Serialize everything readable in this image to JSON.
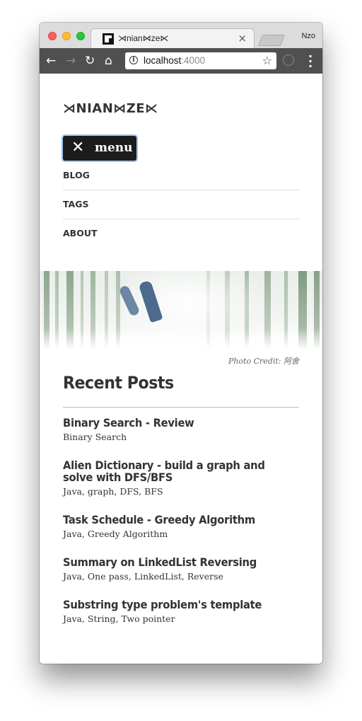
{
  "browser": {
    "tab_title": "⋊nian⋈ze⋉",
    "tab_close": "×",
    "profile_name": "Nzo",
    "url_host": "localhost",
    "url_port": ":4000"
  },
  "site": {
    "logo": "⋊NIAN⋈ZE⋉",
    "menu_button_label": "menu",
    "nav_items": [
      {
        "label": "BLOG"
      },
      {
        "label": "TAGS"
      },
      {
        "label": "ABOUT"
      }
    ],
    "photo_credit": "Photo Credit: 阿舍",
    "section_title": "Recent Posts",
    "posts": [
      {
        "title": "Binary Search - Review",
        "tags": "Binary Search"
      },
      {
        "title": "Alien Dictionary - build a graph and solve with DFS/BFS",
        "tags": "Java, graph, DFS, BFS"
      },
      {
        "title": "Task Schedule - Greedy Algorithm",
        "tags": "Java, Greedy Algorithm"
      },
      {
        "title": "Summary on LinkedList Reversing",
        "tags": "Java, One pass, LinkedList, Reverse"
      },
      {
        "title": "Substring type problem's template",
        "tags": "Java, String, Two pointer"
      }
    ]
  },
  "colors": {
    "accent_focus": "#9fc3f0",
    "text_dark": "#333333",
    "toolbar": "#505050"
  },
  "icons": [
    "back-arrow-icon",
    "forward-arrow-icon",
    "reload-icon",
    "home-icon",
    "info-icon",
    "star-icon",
    "close-icon",
    "kebab-menu-icon"
  ]
}
